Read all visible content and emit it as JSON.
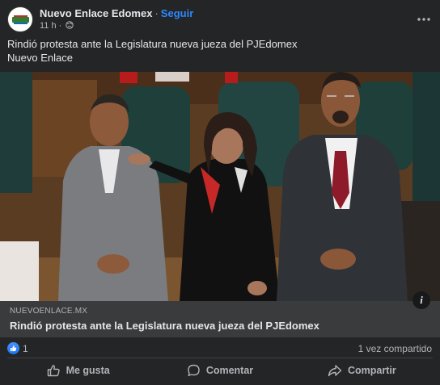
{
  "post": {
    "page_name": "Nuevo Enlace Edomex",
    "follow_label": "Seguir",
    "time": "11 h",
    "text_line1": "Rindió protesta ante la Legislatura nueva jueza del PJEdomex",
    "text_line2": "Nuevo Enlace",
    "avatar_icon": "nuevo-enlace-logo",
    "more_icon": "ellipsis-icon",
    "privacy_icon": "globe-icon"
  },
  "link_preview": {
    "domain": "NUEVOENLACE.MX",
    "title": "Rindió protesta ante la Legislatura nueva jueza del PJEdomex",
    "info_icon": "info-icon"
  },
  "stats": {
    "likes": "1",
    "shares": "1 vez compartido"
  },
  "actions": {
    "like": "Me gusta",
    "comment": "Comentar",
    "share": "Compartir"
  },
  "colors": {
    "background": "#242526",
    "link_preview_bg": "#3a3b3c",
    "accent": "#2d88ff",
    "text": "#e4e6eb",
    "muted": "#b0b3b8"
  }
}
